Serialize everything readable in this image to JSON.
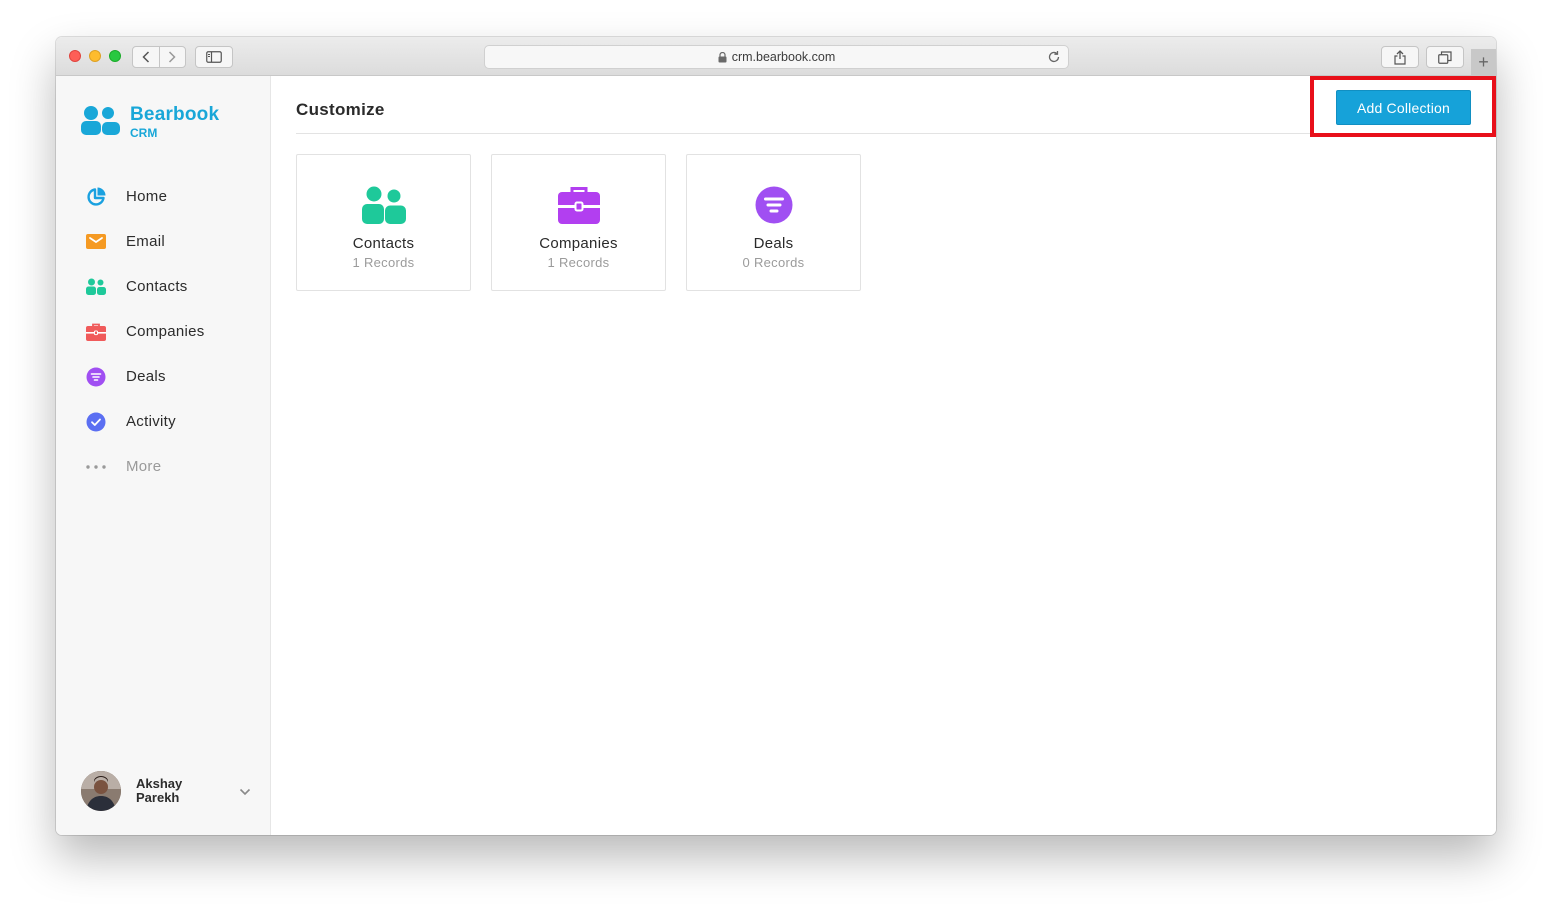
{
  "browser": {
    "url": "crm.bearbook.com",
    "new_tab": "+"
  },
  "app": {
    "name": "Bearbook",
    "subtitle": "CRM"
  },
  "sidebar": {
    "items": [
      {
        "label": "Home",
        "icon": "home-pie-icon",
        "color": "#1aa1e0"
      },
      {
        "label": "Email",
        "icon": "email-icon",
        "color": "#f59a23"
      },
      {
        "label": "Contacts",
        "icon": "contacts-icon",
        "color": "#1ec99a"
      },
      {
        "label": "Companies",
        "icon": "briefcase-icon",
        "color": "#f05a5a"
      },
      {
        "label": "Deals",
        "icon": "funnel-icon",
        "color": "#a04ff2"
      },
      {
        "label": "Activity",
        "icon": "check-circle-icon",
        "color": "#5b6ff2"
      },
      {
        "label": "More",
        "icon": "more-dots-icon",
        "color": "#9a9a9a"
      }
    ],
    "user": {
      "name": "Akshay Parekh"
    }
  },
  "main": {
    "title": "Customize",
    "add_button": "Add Collection",
    "collections": [
      {
        "title": "Contacts",
        "count": "1 Records",
        "icon": "contacts-icon",
        "color": "#1ec99a"
      },
      {
        "title": "Companies",
        "count": "1 Records",
        "icon": "briefcase-icon",
        "color": "#b23ff0"
      },
      {
        "title": "Deals",
        "count": "0 Records",
        "icon": "funnel-icon",
        "color": "#a04ff2"
      }
    ]
  }
}
